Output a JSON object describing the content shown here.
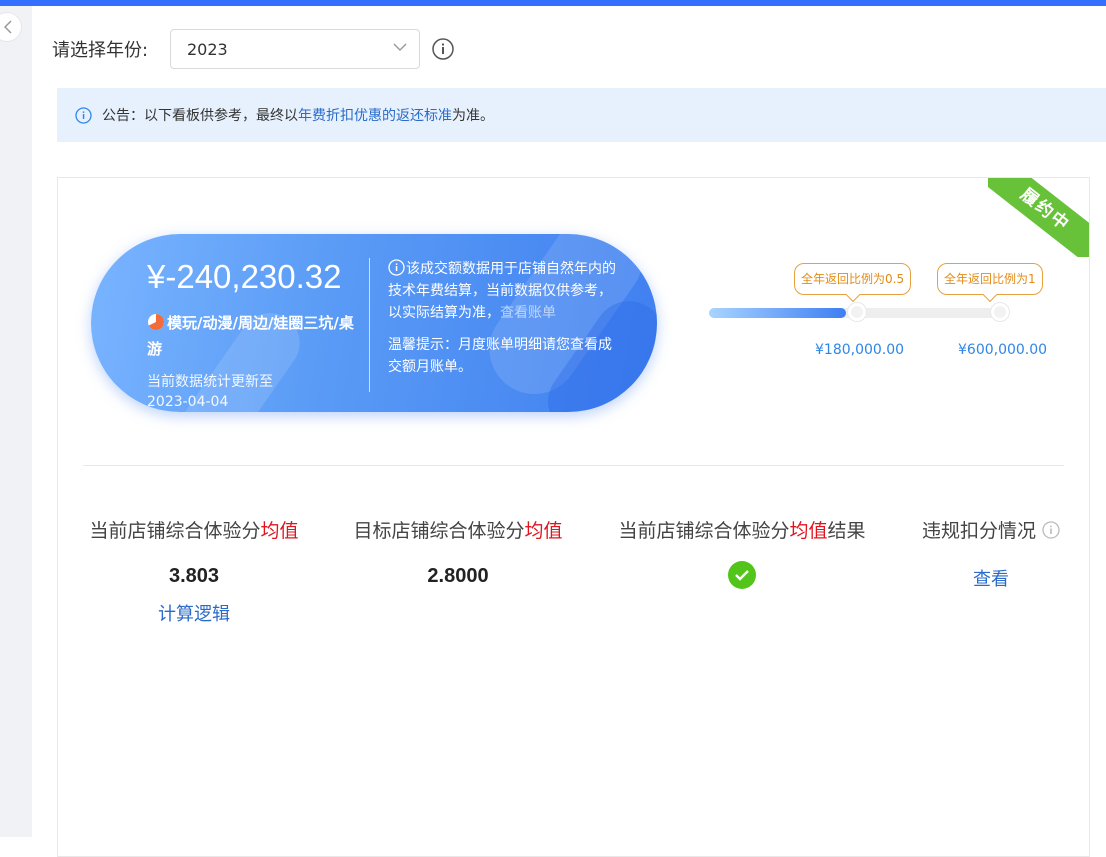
{
  "filter": {
    "label": "请选择年份:",
    "year_value": "2023"
  },
  "notice": {
    "prefix": "公告：以下看板供参考，最终以",
    "link_text": "年费折扣优惠的返还标准",
    "suffix": "为准。"
  },
  "status_ribbon": "履约中",
  "summary": {
    "amount": "¥-240,230.32",
    "category": "模玩/动漫/周边/娃圈三坑/桌游",
    "updated_label": "当前数据统计更新至",
    "updated_date": "2023-04-04",
    "description": "该成交额数据用于店铺自然年内的技术年费结算，当前数据仅供参考，以实际结算为准，",
    "view_bill_link": "查看账单",
    "tip": "温馨提示：月度账单明细请您查看成交额月账单。"
  },
  "progress": {
    "fill_fraction": 0.47,
    "milestones": [
      {
        "tag": "全年返回比例为0.5",
        "amount": "¥180,000.00"
      },
      {
        "tag": "全年返回比例为1",
        "amount": "¥600,000.00"
      }
    ]
  },
  "metrics": [
    {
      "label_prefix": "当前店铺综合体验分",
      "label_highlight": "均值",
      "label_suffix": "",
      "value": "3.803",
      "link": "计算逻辑"
    },
    {
      "label_prefix": "目标店铺综合体验分",
      "label_highlight": "均值",
      "label_suffix": "",
      "value": "2.8000"
    },
    {
      "label_prefix": "当前店铺综合体验分",
      "label_highlight": "均值",
      "label_suffix": "结果",
      "result": "pass"
    },
    {
      "label_prefix": "违规扣分情况",
      "link": "查看"
    }
  ],
  "icons": {
    "collapse": "chevron-left-icon",
    "select": "chevron-down-icon",
    "info": "info-icon",
    "category": "pie-chart-icon",
    "result": "check-circle-icon"
  },
  "colors": {
    "accent": "#3370ff",
    "ribbon": "#67c23a",
    "highlight_red": "#e0141e",
    "link": "#2a6bc9",
    "milestone": "#e28c17"
  }
}
